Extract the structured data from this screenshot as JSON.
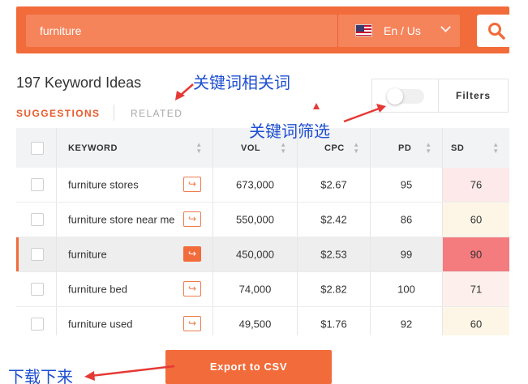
{
  "search": {
    "query": "furniture",
    "language_label": "En / Us",
    "search_button_icon": "search-icon"
  },
  "results": {
    "title": "197 Keyword Ideas",
    "tabs": [
      {
        "label": "SUGGESTIONS",
        "active": true
      },
      {
        "label": "RELATED",
        "active": false
      }
    ],
    "filters_label": "Filters"
  },
  "table": {
    "columns": [
      "KEYWORD",
      "VOL",
      "CPC",
      "PD",
      "SD"
    ],
    "rows": [
      {
        "keyword": "furniture stores",
        "vol": "673,000",
        "cpc": "$2.67",
        "pd": "95",
        "sd": "76",
        "sd_color": "#fde9e9"
      },
      {
        "keyword": "furniture store near me",
        "vol": "550,000",
        "cpc": "$2.42",
        "pd": "86",
        "sd": "60",
        "sd_color": "#fdf6e6"
      },
      {
        "keyword": "furniture",
        "vol": "450,000",
        "cpc": "$2.53",
        "pd": "99",
        "sd": "90",
        "sd_color": "#f47b7e"
      },
      {
        "keyword": "furniture bed",
        "vol": "74,000",
        "cpc": "$2.82",
        "pd": "100",
        "sd": "71",
        "sd_color": "#fdf0ec"
      },
      {
        "keyword": "furniture used",
        "vol": "49,500",
        "cpc": "$1.76",
        "pd": "92",
        "sd": "60",
        "sd_color": "#fdf6e6"
      }
    ]
  },
  "export_label": "Export to CSV",
  "annotations": {
    "related_note": "关键词相关词",
    "filter_note": "关键词筛选",
    "download_note": "下载下来"
  },
  "colors": {
    "accent": "#f26b3a",
    "annotation": "#1e4fd1"
  }
}
